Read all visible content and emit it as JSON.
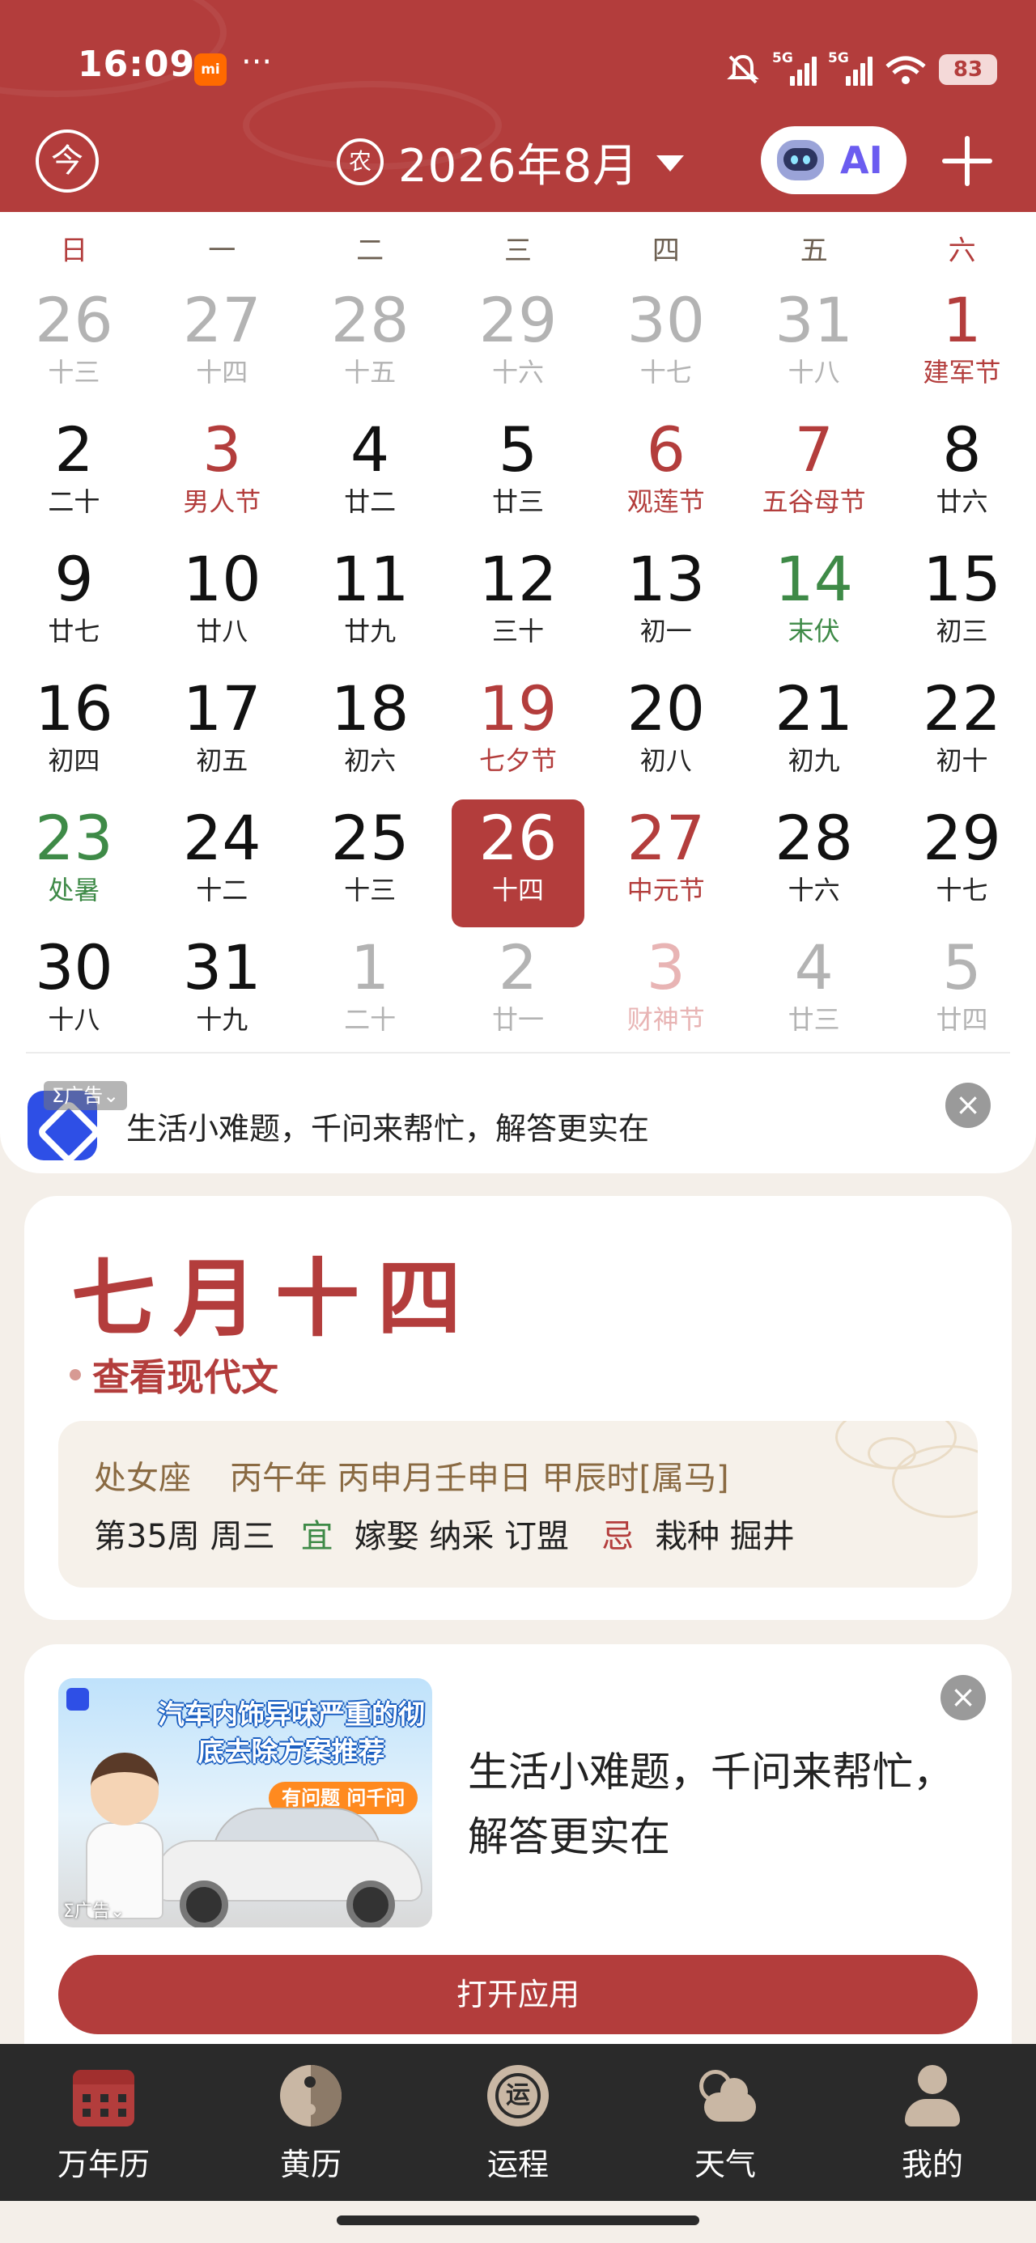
{
  "status_bar": {
    "time": "16:09",
    "app_badge": "mi",
    "more": "···",
    "signal1": "5G",
    "signal2": "5G",
    "battery": "83"
  },
  "toolbar": {
    "today_glyph": "今",
    "lunar_glyph": "农",
    "month_title": "2026年8月",
    "ai_label": "AI"
  },
  "calendar": {
    "weekdays": [
      "日",
      "一",
      "二",
      "三",
      "四",
      "五",
      "六"
    ],
    "weeks": [
      [
        {
          "d": "26",
          "s": "十三",
          "t": "out"
        },
        {
          "d": "27",
          "s": "十四",
          "t": "out"
        },
        {
          "d": "28",
          "s": "十五",
          "t": "out"
        },
        {
          "d": "29",
          "s": "十六",
          "t": "out"
        },
        {
          "d": "30",
          "s": "十七",
          "t": "out"
        },
        {
          "d": "31",
          "s": "十八",
          "t": "out"
        },
        {
          "d": "1",
          "s": "建军节",
          "t": "red"
        }
      ],
      [
        {
          "d": "2",
          "s": "二十",
          "t": ""
        },
        {
          "d": "3",
          "s": "男人节",
          "t": "red"
        },
        {
          "d": "4",
          "s": "廿二",
          "t": ""
        },
        {
          "d": "5",
          "s": "廿三",
          "t": ""
        },
        {
          "d": "6",
          "s": "观莲节",
          "t": "red"
        },
        {
          "d": "7",
          "s": "五谷母节",
          "t": "red"
        },
        {
          "d": "8",
          "s": "廿六",
          "t": ""
        }
      ],
      [
        {
          "d": "9",
          "s": "廿七",
          "t": ""
        },
        {
          "d": "10",
          "s": "廿八",
          "t": ""
        },
        {
          "d": "11",
          "s": "廿九",
          "t": ""
        },
        {
          "d": "12",
          "s": "三十",
          "t": ""
        },
        {
          "d": "13",
          "s": "初一",
          "t": ""
        },
        {
          "d": "14",
          "s": "末伏",
          "t": "green"
        },
        {
          "d": "15",
          "s": "初三",
          "t": ""
        }
      ],
      [
        {
          "d": "16",
          "s": "初四",
          "t": ""
        },
        {
          "d": "17",
          "s": "初五",
          "t": ""
        },
        {
          "d": "18",
          "s": "初六",
          "t": ""
        },
        {
          "d": "19",
          "s": "七夕节",
          "t": "red"
        },
        {
          "d": "20",
          "s": "初八",
          "t": ""
        },
        {
          "d": "21",
          "s": "初九",
          "t": ""
        },
        {
          "d": "22",
          "s": "初十",
          "t": ""
        }
      ],
      [
        {
          "d": "23",
          "s": "处暑",
          "t": "green"
        },
        {
          "d": "24",
          "s": "十二",
          "t": ""
        },
        {
          "d": "25",
          "s": "十三",
          "t": ""
        },
        {
          "d": "26",
          "s": "十四",
          "t": "sel"
        },
        {
          "d": "27",
          "s": "中元节",
          "t": "red"
        },
        {
          "d": "28",
          "s": "十六",
          "t": ""
        },
        {
          "d": "29",
          "s": "十七",
          "t": ""
        }
      ],
      [
        {
          "d": "30",
          "s": "十八",
          "t": ""
        },
        {
          "d": "31",
          "s": "十九",
          "t": ""
        },
        {
          "d": "1",
          "s": "二十",
          "t": "out"
        },
        {
          "d": "2",
          "s": "廿一",
          "t": "out"
        },
        {
          "d": "3",
          "s": "财神节",
          "t": "outred"
        },
        {
          "d": "4",
          "s": "廿三",
          "t": "out"
        },
        {
          "d": "5",
          "s": "廿四",
          "t": "out"
        }
      ]
    ]
  },
  "ad_banner": {
    "tag": "Σ广告⌄",
    "text": "生活小难题，千问来帮忙，解答更实在",
    "close": "×"
  },
  "date_card": {
    "lunar_date": "七月十四",
    "modern_link": "查看现代文",
    "zodiac": "处女座",
    "ganzhi": "丙午年 丙申月壬申日 甲辰时[属马]",
    "week": "第35周 周三",
    "yi_label": "宜",
    "yi": "嫁娶 纳采 订盟",
    "ji_label": "忌",
    "ji": "栽种 掘井"
  },
  "ad_card": {
    "image_headline": "汽车内饰异味严重的彻底去除方案推荐",
    "image_pill": "有问题 问千问",
    "image_tag": "Σ广告⌄",
    "description": "生活小难题，千问来帮忙，解答更实在",
    "close": "×",
    "open_button": "打开应用"
  },
  "bottom_nav": {
    "items": [
      {
        "label": "万年历",
        "icon": "calendar-icon"
      },
      {
        "label": "黄历",
        "icon": "yin-yang-icon"
      },
      {
        "label": "运程",
        "icon": "fortune-icon"
      },
      {
        "label": "天气",
        "icon": "weather-icon"
      },
      {
        "label": "我的",
        "icon": "user-icon"
      }
    ],
    "fortune_glyph": "运"
  },
  "colors": {
    "brand_red": "#b33d3c",
    "festival_red": "#b33d3c",
    "solar_term_green": "#3e8a47",
    "nav_bg": "#2a2a2a"
  }
}
